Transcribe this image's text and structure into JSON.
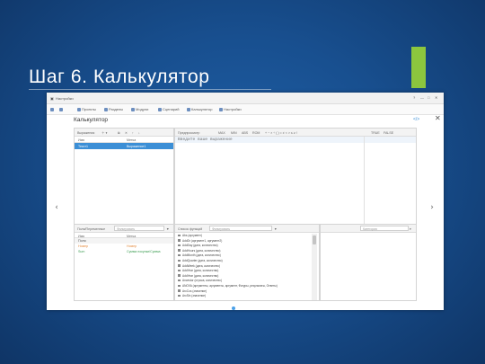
{
  "slide": {
    "title": "Шаг 6. Калькулятор",
    "accent_color": "#8cc63e"
  },
  "window": {
    "app_title": "Настройки",
    "controls": [
      "?",
      "—",
      "□",
      "✕"
    ]
  },
  "toolbar": {
    "items": [
      {
        "icon": "home-icon",
        "label": ""
      },
      {
        "icon": "save-icon",
        "label": ""
      },
      {
        "icon": "folder-icon",
        "label": "Проекты"
      },
      {
        "icon": "folder-icon",
        "label": "Разделы"
      },
      {
        "icon": "folder-icon",
        "label": "Модули"
      },
      {
        "icon": "refresh-icon",
        "label": "Сценарий"
      },
      {
        "icon": "calc-icon",
        "label": "Калькулятор"
      },
      {
        "icon": "gear-icon",
        "label": "Настройки"
      }
    ]
  },
  "calculator": {
    "heading": "Калькулятор",
    "expressions_panel": {
      "label": "Выражения",
      "columns": [
        "Имя",
        "Метка"
      ],
      "rows": [
        {
          "name": "Текст1",
          "tag": "Выражение1"
        }
      ]
    },
    "editor_toolbar": [
      "Предпросмотр",
      "MAX",
      "MIN",
      "ABS",
      "ROM",
      "TRUE",
      "FALSE"
    ],
    "editor_placeholder": "Введите ваше выражение",
    "fields_panel": {
      "label": "Поля/Переменные",
      "search_placeholder": "Фильтровать",
      "columns": [
        "Имя",
        "Метка"
      ],
      "group": "Поля",
      "rows": [
        {
          "name": "Номер",
          "tag": "Номер",
          "color": "#e58a3c"
        },
        {
          "name": "Sum",
          "tag": "Сумма покупки/Сумма",
          "color": "#3c9d52"
        }
      ]
    },
    "functions_panel": {
      "label": "Список функций",
      "search_placeholder": "Фильтровать",
      "items": [
        "Abs (аргумент)",
        "AddDr (аргумент1, аргумент2)",
        "AddDay (дата, количество)",
        "AddHours (дата, количество)",
        "AddMonth (дата, количество)",
        "AddQuarter (дата, количество)",
        "AddWeek (дата, количество)",
        "AddYear (дата, количество)",
        "AddYear (дата, количество)",
        "Ancestor (строка, количество)",
        "ANOVA (аргументы, аргументы, аргумент, Фигуры, результаты, Ответы)",
        "ArcCos (значение)",
        "ArcSin (значение)"
      ]
    },
    "category_placeholder": "Категория"
  },
  "pager": {
    "total": 3,
    "active": 0
  }
}
